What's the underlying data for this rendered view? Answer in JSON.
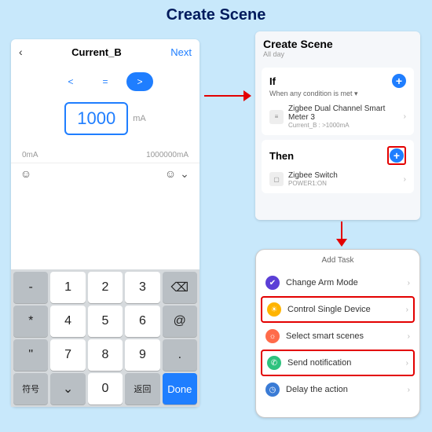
{
  "title": "Create Scene",
  "panel1": {
    "header_title": "Current_B",
    "next": "Next",
    "op_lt": "<",
    "op_eq": "=",
    "op_gt": ">",
    "value": "1000",
    "unit": "mA",
    "min": "0mA",
    "max": "1000000mA",
    "keys": {
      "r1c1": "-",
      "r1c2": "1",
      "r1c3": "2",
      "r1c4": "3",
      "bksp": "⌫",
      "r2c1": "*",
      "r2c2": "4",
      "r2c3": "5",
      "r2c4": "6",
      "at": "@",
      "r3c1": "\"",
      "r3c2": "7",
      "r3c3": "8",
      "r3c4": "9",
      "period": ".",
      "sym": "符号",
      "mic": "⌄",
      "zero": "0",
      "space": "␣",
      "ret": "返回",
      "done": "Done"
    }
  },
  "panel2": {
    "title": "Create Scene",
    "sub": "All day",
    "if_label": "If",
    "if_cond": "When any condition is met ▾",
    "if_dev": "Zigbee Dual Channel Smart Meter 3",
    "if_det": "Current_B : >1000mA",
    "then_label": "Then",
    "then_dev": "Zigbee Switch",
    "then_det": "POWER1:ON"
  },
  "panel3": {
    "title": "Add Task",
    "items": [
      {
        "icon": "shield",
        "color": "#5b3fd6",
        "label": "Change Arm Mode"
      },
      {
        "icon": "bulb",
        "color": "#ffb400",
        "label": "Control Single Device"
      },
      {
        "icon": "scene",
        "color": "#ff6b4a",
        "label": "Select smart scenes"
      },
      {
        "icon": "notif",
        "color": "#2ec27e",
        "label": "Send notification"
      },
      {
        "icon": "delay",
        "color": "#3a7bd5",
        "label": "Delay the action"
      }
    ]
  }
}
